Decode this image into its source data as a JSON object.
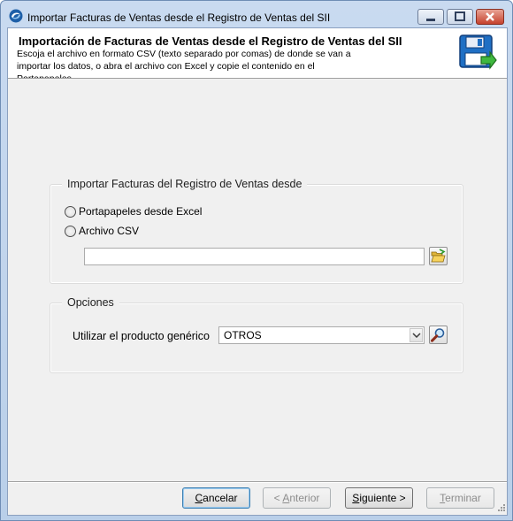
{
  "window": {
    "title": "Importar Facturas de Ventas desde el Registro de Ventas del SII",
    "icons": {
      "app": "sii-swirl-icon",
      "minimize": "minimize-icon",
      "maximize": "maximize-icon",
      "close": "close-icon"
    }
  },
  "header": {
    "title": "Importación de Facturas de Ventas desde el Registro de Ventas del SII",
    "description": "Escoja el archivo en formato CSV (texto separado por comas) de donde se van a importar los datos, o abra el archivo con Excel y copie el contenido en el Portapapeles",
    "icon": "floppy-disk-import-icon"
  },
  "source_group": {
    "legend": "Importar Facturas del Registro de Ventas desde",
    "options": [
      {
        "label": "Portapapeles desde Excel",
        "selected": false
      },
      {
        "label": "Archivo CSV",
        "selected": false
      }
    ],
    "file_path": "",
    "browse_icon": "open-folder-icon"
  },
  "options_group": {
    "legend": "Opciones",
    "product_label": "Utilizar el producto genérico",
    "product_value": "OTROS",
    "search_icon": "magnifier-icon"
  },
  "buttons": {
    "cancel": {
      "prefix": "",
      "accel": "C",
      "rest": "ancelar"
    },
    "back": {
      "prefix": "< ",
      "accel": "A",
      "rest": "nterior"
    },
    "next": {
      "prefix": "",
      "accel": "S",
      "rest": "iguiente >"
    },
    "finish": {
      "prefix": "",
      "accel": "T",
      "rest": "erminar"
    }
  }
}
